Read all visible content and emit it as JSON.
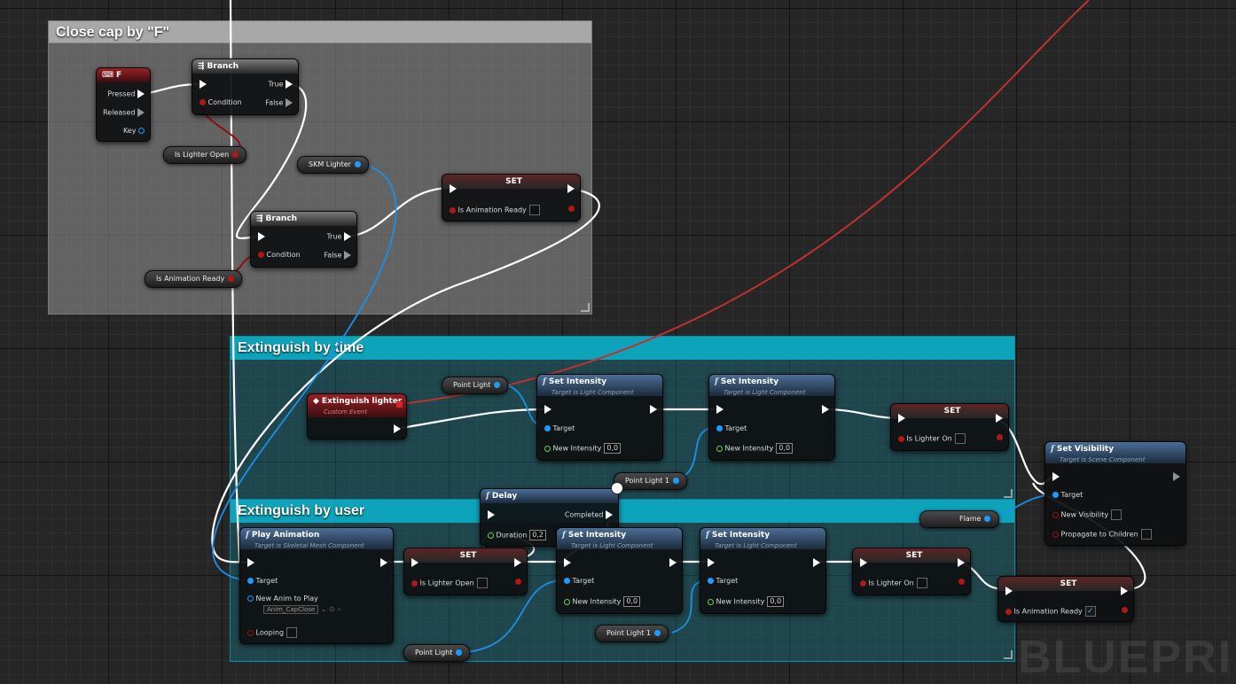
{
  "comments": {
    "close_cap": "Close cap by \"F\"",
    "extinguish_time": "Extinguish by time",
    "extinguish_user": "Extinguish by user"
  },
  "nodes": {
    "key_f": {
      "title": "F",
      "pressed": "Pressed",
      "released": "Released",
      "key": "Key"
    },
    "branch1": {
      "title": "Branch",
      "true": "True",
      "false": "False",
      "condition": "Condition"
    },
    "branch2": {
      "title": "Branch",
      "true": "True",
      "false": "False",
      "condition": "Condition"
    },
    "set_anim_ready_1": {
      "title": "SET",
      "label": "Is Animation Ready"
    },
    "extinguish_event": {
      "title": "Extinguish lighter",
      "subtitle": "Custom Event"
    },
    "set_intensity_1": {
      "title": "Set Intensity",
      "subtitle": "Target is Light Component",
      "target": "Target",
      "new_intensity": "New Intensity",
      "value": "0,0"
    },
    "set_intensity_2": {
      "title": "Set Intensity",
      "subtitle": "Target is Light Component",
      "target": "Target",
      "new_intensity": "New Intensity",
      "value": "0,0"
    },
    "set_lighter_on_1": {
      "title": "SET",
      "label": "Is Lighter On"
    },
    "set_visibility": {
      "title": "Set Visibility",
      "subtitle": "Target is Scene Component",
      "target": "Target",
      "new_visibility": "New Visibility",
      "propagate": "Propagate to Children"
    },
    "delay": {
      "title": "Delay",
      "completed": "Completed",
      "duration": "Duration",
      "value": "0,2"
    },
    "play_animation": {
      "title": "Play Animation",
      "subtitle": "Target is Skeletal Mesh Component",
      "target": "Target",
      "new_anim": "New Anim to Play",
      "anim_value": "Anim_CapClose",
      "looping": "Looping"
    },
    "set_lighter_open": {
      "title": "SET",
      "label": "Is Lighter Open"
    },
    "set_intensity_3": {
      "title": "Set Intensity",
      "subtitle": "Target is Light Component",
      "target": "Target",
      "new_intensity": "New Intensity",
      "value": "0,0"
    },
    "set_intensity_4": {
      "title": "Set Intensity",
      "subtitle": "Target is Light Component",
      "target": "Target",
      "new_intensity": "New Intensity",
      "value": "0,0"
    },
    "set_lighter_on_2": {
      "title": "SET",
      "label": "Is Lighter On"
    },
    "set_anim_ready_2": {
      "title": "SET",
      "label": "Is Animation Ready",
      "checked": "✓"
    }
  },
  "variables": {
    "is_lighter_open": "Is Lighter Open",
    "skm_lighter": "SKM Lighter",
    "is_animation_ready": "Is Animation Ready",
    "point_light_a": "Point Light",
    "point_light_1_a": "Point Light 1",
    "flame": "Flame",
    "point_light_b": "Point Light",
    "point_light_1_b": "Point Light 1"
  },
  "watermark": "BLUEPRIN",
  "colors": {
    "exec": "#ffffff",
    "bool": "#a01010",
    "object": "#1e9bff",
    "float": "#6ed04a",
    "event_wire": "#c03030"
  }
}
